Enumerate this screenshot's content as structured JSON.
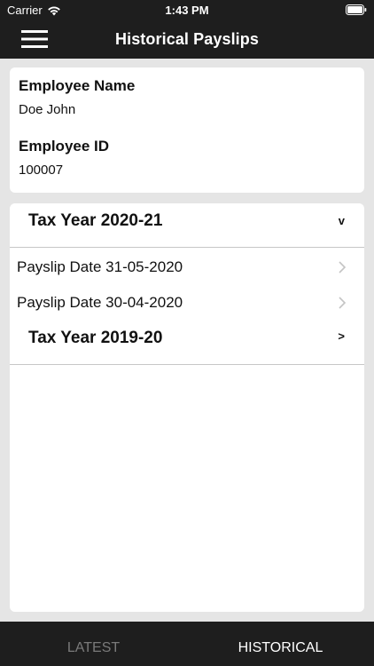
{
  "status_bar": {
    "carrier": "Carrier",
    "time": "1:43 PM"
  },
  "nav": {
    "title": "Historical Payslips",
    "menu_icon": "hamburger-menu-icon"
  },
  "employee": {
    "name_label": "Employee Name",
    "name_value": "Doe John",
    "id_label": "Employee ID",
    "id_value": "100007"
  },
  "tax_years": [
    {
      "title": "Tax Year 2020-21",
      "toggle": "v",
      "expanded": true,
      "payslips": [
        {
          "label": "Payslip Date 31-05-2020"
        },
        {
          "label": "Payslip Date 30-04-2020"
        }
      ]
    },
    {
      "title": "Tax Year 2019-20",
      "toggle": ">",
      "expanded": false,
      "payslips": []
    }
  ],
  "tabs": [
    {
      "label": "LATEST",
      "active": false
    },
    {
      "label": "HISTORICAL",
      "active": true
    }
  ],
  "colors": {
    "bar_background": "#1e1e1e",
    "page_background": "#e5e5e5",
    "card_background": "#ffffff",
    "inactive_tab": "#7a7a7a",
    "active_tab": "#ffffff"
  }
}
